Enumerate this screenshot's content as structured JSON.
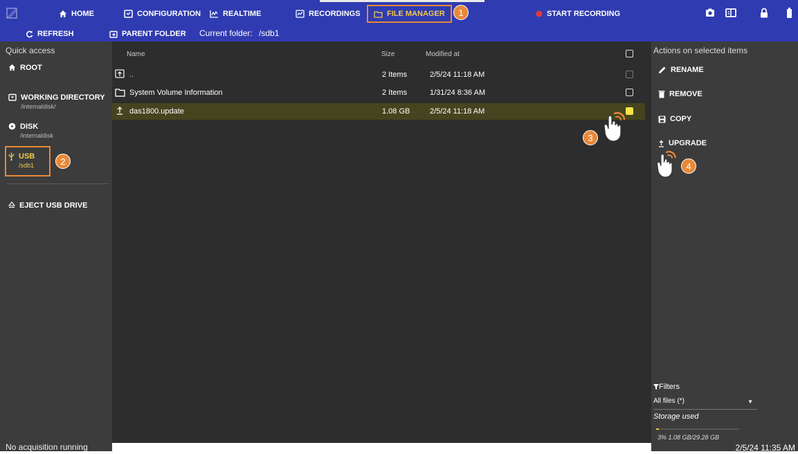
{
  "topbar": {
    "nav": [
      {
        "label": "HOME",
        "icon": "home-icon"
      },
      {
        "label": "CONFIGURATION",
        "icon": "configuration-icon"
      },
      {
        "label": "REALTIME",
        "icon": "realtime-icon"
      },
      {
        "label": "RECORDINGS",
        "icon": "recordings-icon"
      },
      {
        "label": "FILE MANAGER",
        "icon": "folder-icon",
        "active": true
      },
      {
        "label": "START RECORDING",
        "icon": "record-dot-icon"
      }
    ],
    "right_icons": [
      "camera-icon",
      "book-icon",
      "lock-icon",
      "battery-icon"
    ],
    "accent_color": "#e8893a",
    "active_color": "#f2c94c",
    "record_color": "#e53935",
    "bar_color": "#2f3bb0"
  },
  "subbar": {
    "refresh_label": "REFRESH",
    "parent_label": "PARENT FOLDER",
    "folder_label": "Current folder:",
    "folder_value": "/sdb1"
  },
  "quick_access": {
    "title": "Quick access",
    "items": [
      {
        "label": "ROOT",
        "sub": "",
        "icon": "home-icon"
      },
      {
        "label": "WORKING DIRECTORY",
        "sub": "/internaldisk/",
        "icon": "folder-icon"
      },
      {
        "label": "DISK",
        "sub": "/internaldisk",
        "icon": "disk-icon"
      },
      {
        "label": "USB",
        "sub": "/sdb1",
        "icon": "usb-icon",
        "selected": true
      }
    ],
    "eject_label": "EJECT USB DRIVE"
  },
  "file_table": {
    "headers": {
      "name": "Name",
      "size": "Size",
      "modified": "Modified at"
    },
    "rows": [
      {
        "name": "..",
        "size": "2 Items",
        "modified": "2/5/24 11:18 AM",
        "icon": "parent-folder-icon",
        "checked": false
      },
      {
        "name": "System Volume Information",
        "size": "2 Items",
        "modified": "1/31/24 8:36 AM",
        "icon": "folder-icon",
        "checked": false
      },
      {
        "name": "das1800.update",
        "size": "1.08 GB",
        "modified": "2/5/24 11:18 AM",
        "icon": "upload-file-icon",
        "checked": true
      }
    ]
  },
  "actions": {
    "title": "Actions on selected items",
    "items": [
      {
        "label": "RENAME",
        "icon": "pencil-icon"
      },
      {
        "label": "REMOVE",
        "icon": "trash-icon"
      },
      {
        "label": "COPY",
        "icon": "save-icon"
      },
      {
        "label": "UPGRADE",
        "icon": "upgrade-icon"
      }
    ],
    "filters_label": "Filters",
    "filter_value": "All files (*)",
    "storage_label": "Storage used",
    "storage_fraction": 0.03,
    "storage_info": "3% 1.08 GB/29.28 GB"
  },
  "status": {
    "acquisition": "No acquisition running",
    "clock": "2/5/24 11:35 AM"
  },
  "annotations": {
    "steps": [
      "1",
      "2",
      "3",
      "4"
    ]
  }
}
